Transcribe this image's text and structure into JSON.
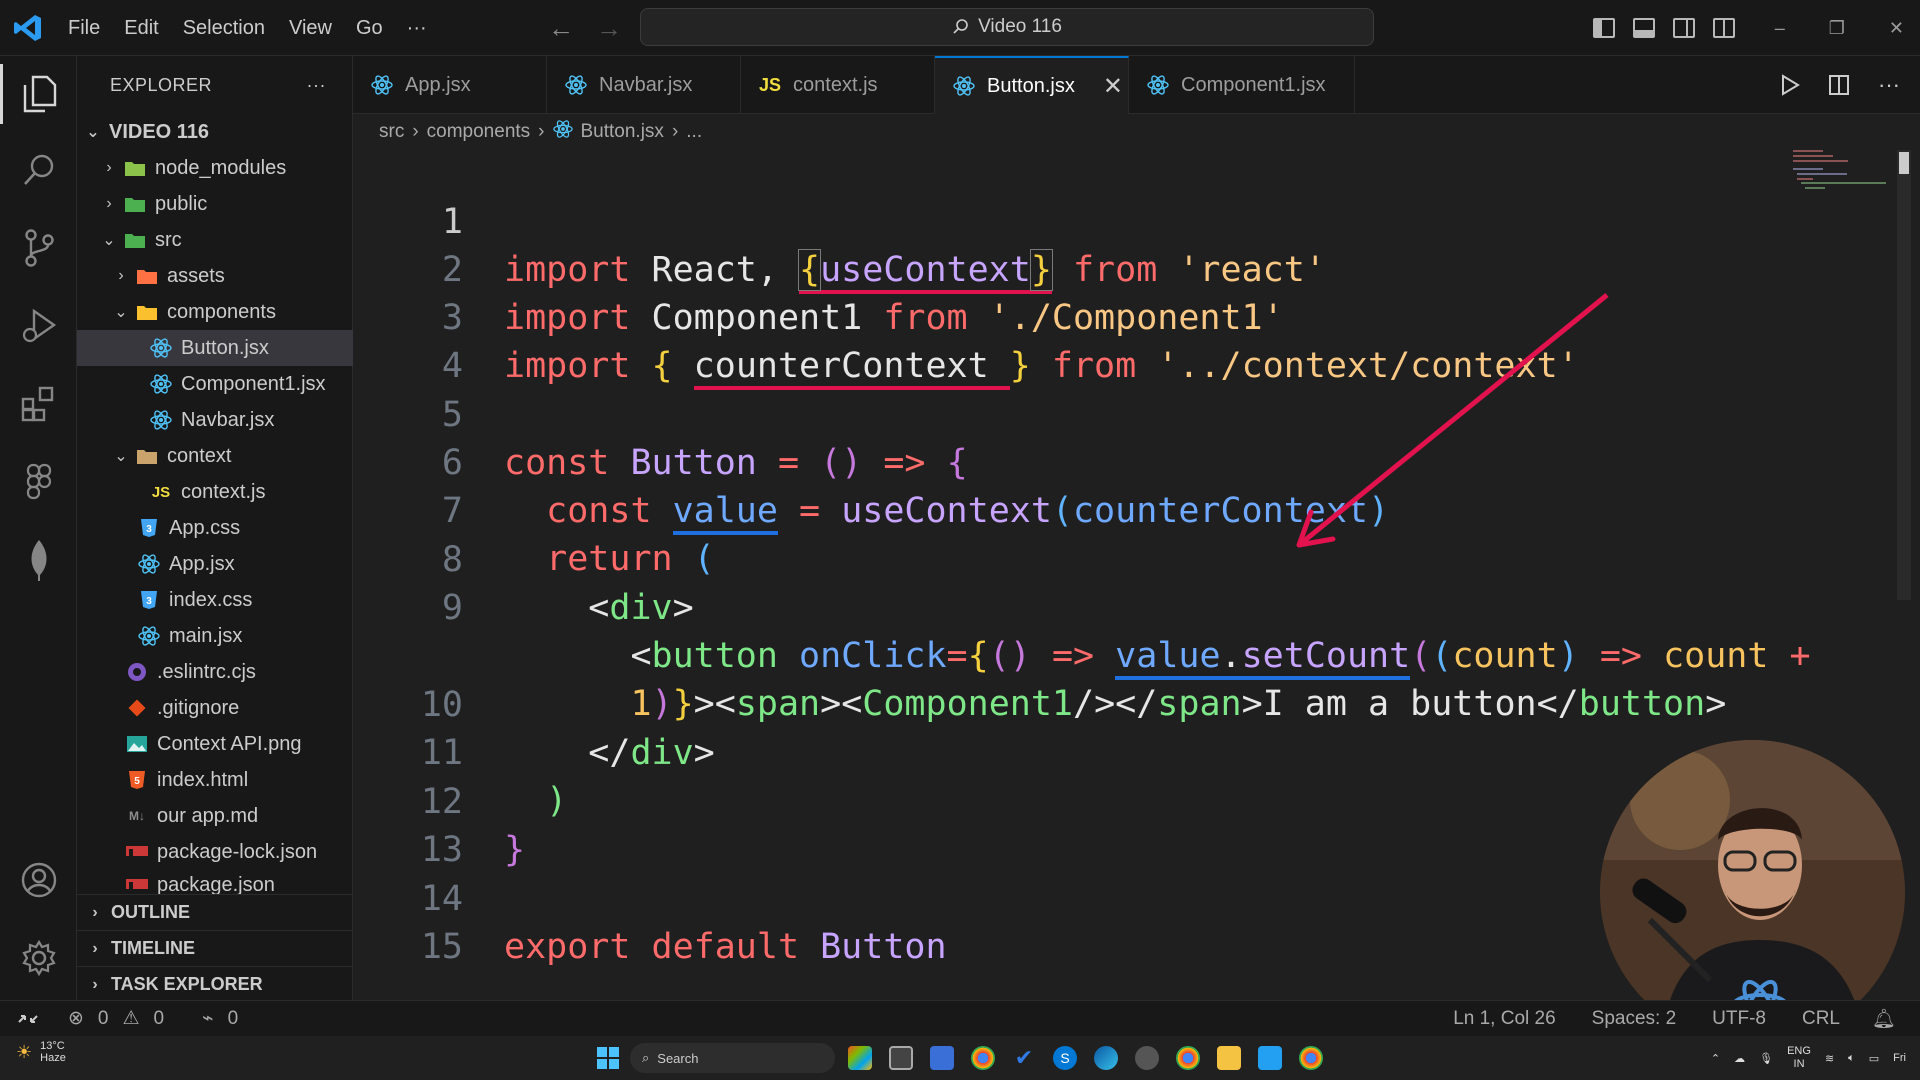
{
  "titlebar": {
    "menu": [
      "File",
      "Edit",
      "Selection",
      "View",
      "Go",
      "···"
    ],
    "search_text": "Video 116"
  },
  "sidebar": {
    "title": "EXPLORER",
    "more": "···",
    "root": "VIDEO 116",
    "items": [
      {
        "label": "node_modules"
      },
      {
        "label": "public"
      },
      {
        "label": "src"
      },
      {
        "label": "assets"
      },
      {
        "label": "components"
      },
      {
        "label": "Button.jsx"
      },
      {
        "label": "Component1.jsx"
      },
      {
        "label": "Navbar.jsx"
      },
      {
        "label": "context"
      },
      {
        "label": "context.js"
      },
      {
        "label": "App.css"
      },
      {
        "label": "App.jsx"
      },
      {
        "label": "index.css"
      },
      {
        "label": "main.jsx"
      },
      {
        "label": ".eslintrc.cjs"
      },
      {
        "label": ".gitignore"
      },
      {
        "label": "Context API.png"
      },
      {
        "label": "index.html"
      },
      {
        "label": "our app.md"
      },
      {
        "label": "package-lock.json"
      },
      {
        "label": "package.json"
      }
    ],
    "sections": [
      "OUTLINE",
      "TIMELINE",
      "TASK EXPLORER"
    ]
  },
  "tabs": [
    {
      "label": "App.jsx"
    },
    {
      "label": "Navbar.jsx"
    },
    {
      "label": "context.js"
    },
    {
      "label": "Button.jsx"
    },
    {
      "label": "Component1.jsx"
    }
  ],
  "breadcrumb": [
    "src",
    "components",
    "Button.jsx",
    "..."
  ],
  "code": {
    "line_numbers": [
      "1",
      "2",
      "3",
      "4",
      "5",
      "6",
      "7",
      "8",
      "9",
      "",
      "10",
      "11",
      "12",
      "13",
      "14",
      "15"
    ]
  },
  "statusbar": {
    "errors": "0",
    "warnings": "0",
    "ports": "0",
    "position": "Ln 1, Col 26",
    "spaces": "Spaces: 2",
    "encoding": "UTF-8",
    "eol": "CRL"
  },
  "taskbar": {
    "temp": "13°C",
    "weather": "Haze",
    "search": "Search",
    "lang": "ENG",
    "region": "IN",
    "day": "Fri"
  }
}
